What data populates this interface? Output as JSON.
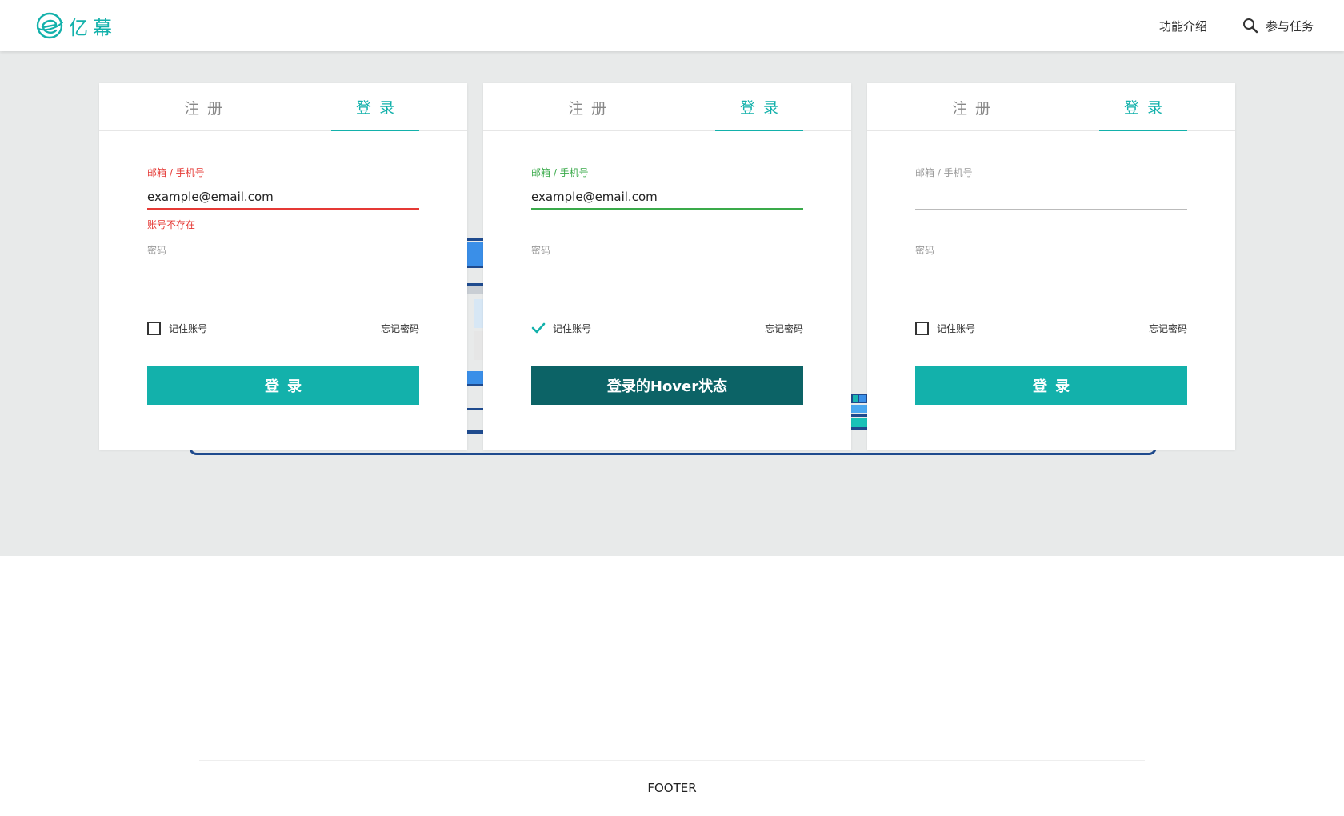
{
  "header": {
    "logo_text": "亿幕",
    "nav": [
      {
        "label": "功能介绍"
      },
      {
        "label": "参与任务",
        "icon": "search-icon"
      }
    ]
  },
  "cards": [
    {
      "state": "error",
      "tabs": {
        "register": "注册",
        "login": "登录"
      },
      "user_label": "邮箱 / 手机号",
      "user_value": "example@email.com",
      "error_text": "账号不存在",
      "password_label": "密码",
      "password_value": "",
      "remember_label": "记住账号",
      "remember_checked": false,
      "forgot_label": "忘记密码",
      "submit_label": "登录"
    },
    {
      "state": "ok",
      "tabs": {
        "register": "注册",
        "login": "登录"
      },
      "user_label": "邮箱 / 手机号",
      "user_value": "example@email.com",
      "password_label": "密码",
      "password_value": "",
      "remember_label": "记住账号",
      "remember_checked": true,
      "forgot_label": "忘记密码",
      "submit_label": "登录的Hover状态"
    },
    {
      "state": "default",
      "tabs": {
        "register": "注册",
        "login": "登录"
      },
      "user_label": "邮箱 / 手机号",
      "user_value": "",
      "password_label": "密码",
      "password_value": "",
      "remember_label": "记住账号",
      "remember_checked": false,
      "forgot_label": "忘记密码",
      "submit_label": "登录"
    }
  ],
  "footer": {
    "text": "FOOTER"
  },
  "colors": {
    "accent": "#13b1ab",
    "accent_dark": "#0c6366",
    "error": "#e53935",
    "success": "#3aaa4a",
    "band": "#e8eaea"
  }
}
